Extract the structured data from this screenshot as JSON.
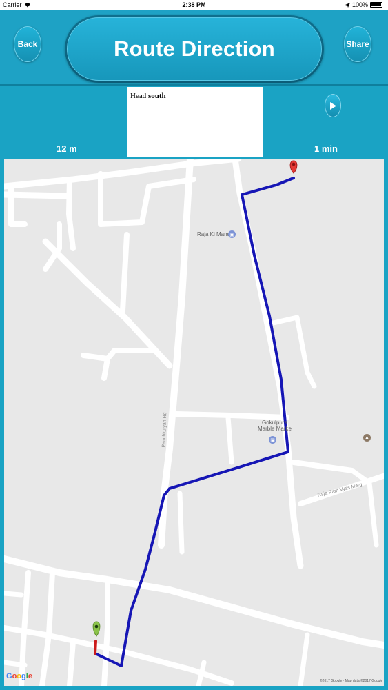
{
  "status_bar": {
    "carrier": "Carrier",
    "time": "2:38 PM",
    "battery": "100%"
  },
  "header": {
    "back_label": "Back",
    "title": "Route Direction",
    "share_label": "Share"
  },
  "step": {
    "distance": "12 m",
    "duration": "1 min",
    "instruction_prefix": "Head",
    "instruction_direction": "south"
  },
  "map": {
    "labels": {
      "poi_1": "Raja Ki Mandi",
      "poi_2_line1": "Gokulpura",
      "poi_2_line2": "Marble Marke",
      "road_1": "Panchkuiyan Rd",
      "road_2": "Raja Ram Vyas Marg"
    },
    "logo": "Google",
    "attribution": "©2017 Google · Map data ©2017 Google",
    "colors": {
      "route": "#1616b5",
      "route_start_segment": "#cc1b1b",
      "destination_pin": "#e53935",
      "origin_pin": "#8bc34a",
      "road": "#ffffff",
      "land": "#e8e8e8"
    }
  }
}
